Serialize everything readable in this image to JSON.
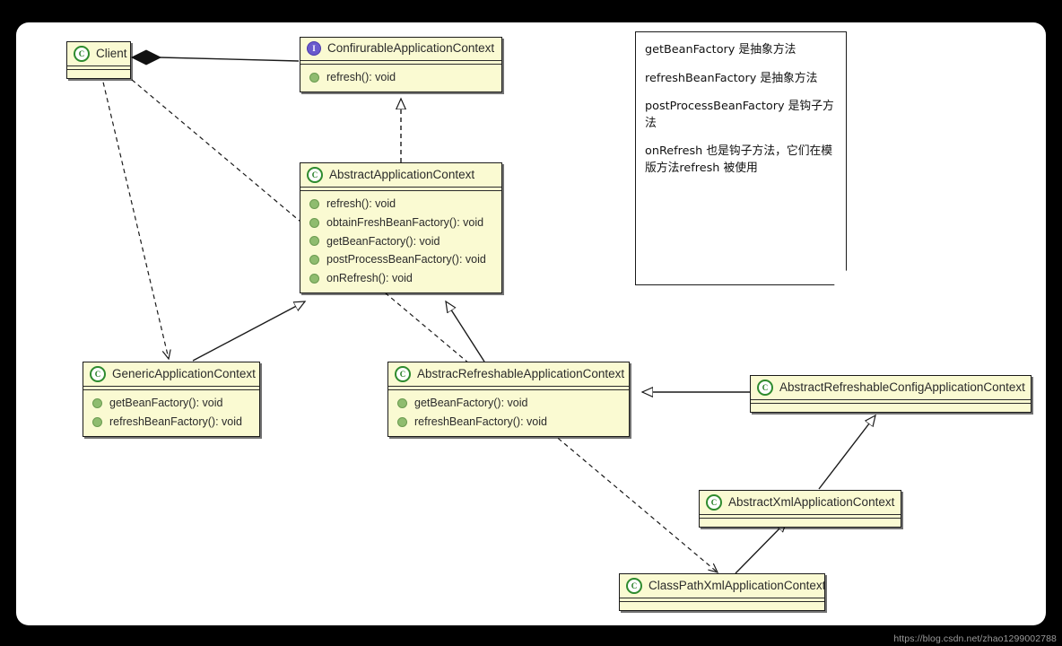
{
  "diagram": {
    "title": "Spring ApplicationContext UML class diagram",
    "watermark": "https://blog.csdn.net/zhao1299002788",
    "colors": {
      "box_fill": "#fafad2",
      "box_border": "#1a1a1a",
      "class_icon": "#2e8b2e",
      "interface_icon": "#6a5acd",
      "method_icon": "#8fbc6f",
      "canvas": "#ffffff",
      "backdrop": "#000000"
    }
  },
  "classes": {
    "client": {
      "name": "Client",
      "stereotype": "class",
      "icon": "class-icon",
      "members": []
    },
    "configurable_application_context": {
      "name": "ConfirurableApplicationContext",
      "stereotype": "interface",
      "icon": "interface-icon",
      "members": [
        "refresh(): void"
      ]
    },
    "abstract_application_context": {
      "name": "AbstractApplicationContext",
      "stereotype": "class",
      "icon": "class-icon",
      "members": [
        "refresh(): void",
        "obtainFreshBeanFactory(): void",
        "getBeanFactory(): void",
        "postProcessBeanFactory(): void",
        "onRefresh(): void"
      ]
    },
    "generic_application_context": {
      "name": "GenericApplicationContext",
      "stereotype": "class",
      "icon": "class-icon",
      "members": [
        "getBeanFactory(): void",
        "refreshBeanFactory(): void"
      ]
    },
    "abstract_refreshable_application_context": {
      "name": "AbstracRefreshableApplicationContext",
      "stereotype": "class",
      "icon": "class-icon",
      "members": [
        "getBeanFactory(): void",
        "refreshBeanFactory(): void"
      ]
    },
    "abstract_refreshable_config_application_context": {
      "name": "AbstractRefreshableConfigApplicationContext",
      "stereotype": "class",
      "icon": "class-icon",
      "members": []
    },
    "abstract_xml_application_context": {
      "name": "AbstractXmlApplicationContext",
      "stereotype": "class",
      "icon": "class-icon",
      "members": []
    },
    "class_path_xml_application_context": {
      "name": "ClassPathXmlApplicationContext",
      "stereotype": "class",
      "icon": "class-icon",
      "members": []
    }
  },
  "note": {
    "lines": [
      "getBeanFactory 是抽象方法",
      "refreshBeanFactory 是抽象方法",
      "postProcessBeanFactory 是钩子方法",
      "onRefresh 也是钩子方法，它们在模版方法refresh 被使用"
    ]
  },
  "relations": [
    {
      "from": "client",
      "to": "configurable_application_context",
      "type": "composition"
    },
    {
      "from": "abstract_application_context",
      "to": "configurable_application_context",
      "type": "realization"
    },
    {
      "from": "generic_application_context",
      "to": "abstract_application_context",
      "type": "inheritance"
    },
    {
      "from": "abstract_refreshable_application_context",
      "to": "abstract_application_context",
      "type": "inheritance"
    },
    {
      "from": "abstract_refreshable_config_application_context",
      "to": "abstract_refreshable_application_context",
      "type": "inheritance"
    },
    {
      "from": "abstract_xml_application_context",
      "to": "abstract_refreshable_config_application_context",
      "type": "inheritance"
    },
    {
      "from": "class_path_xml_application_context",
      "to": "abstract_xml_application_context",
      "type": "inheritance"
    },
    {
      "from": "client",
      "to": "generic_application_context",
      "type": "dependency"
    },
    {
      "from": "client",
      "to": "class_path_xml_application_context",
      "type": "dependency"
    }
  ]
}
